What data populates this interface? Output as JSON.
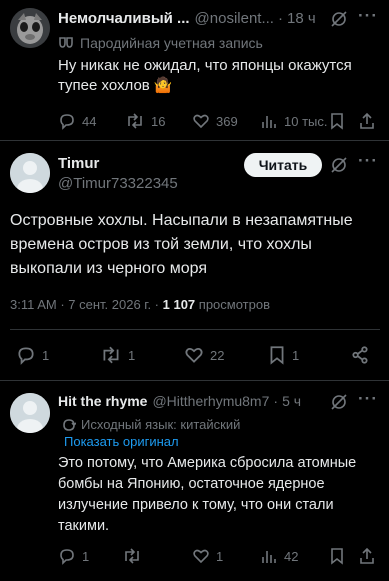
{
  "tweet1": {
    "name": "Немолчаливый ...",
    "handle": "@nosilent...",
    "time": "18 ч",
    "parody_label": "Пародийная учетная запись",
    "text": "Ну никак не ожидал, что японцы окажутся тупее хохлов 🤷",
    "replies": "44",
    "reposts": "16",
    "likes": "369",
    "views": "10 тыс."
  },
  "tweet2": {
    "name": "Timur",
    "handle": "@Timur73322345",
    "follow_label": "Читать",
    "text": "Островные хохлы. Насыпали в незапамятные времена остров из той земли, что хохлы выкопали из черного моря",
    "meta_time": "3:11 AM · 7 сент. 2026 г. · ",
    "meta_views_count": "1 107",
    "meta_views_label": " просмотров",
    "replies": "1",
    "reposts": "1",
    "likes": "22",
    "bookmarks": "1"
  },
  "tweet3": {
    "name": "Hit the rhyme",
    "handle": "@Hittherhymu8m7",
    "time": "5 ч",
    "translated_label": "Исходный язык: китайский",
    "show_original": "Показать оригинал",
    "text": "Это потому, что Америка сбросила атомные бомбы на Японию, остаточное ядерное излучение привело к тому, что они стали такими.",
    "replies": "1",
    "likes": "1",
    "views": "42"
  },
  "icons": [
    "avatar",
    "grok-icon",
    "more-icon",
    "reply-icon",
    "repost-icon",
    "like-icon",
    "views-icon",
    "bookmark-icon",
    "share-icon",
    "translate-icon",
    "parody-icon"
  ]
}
